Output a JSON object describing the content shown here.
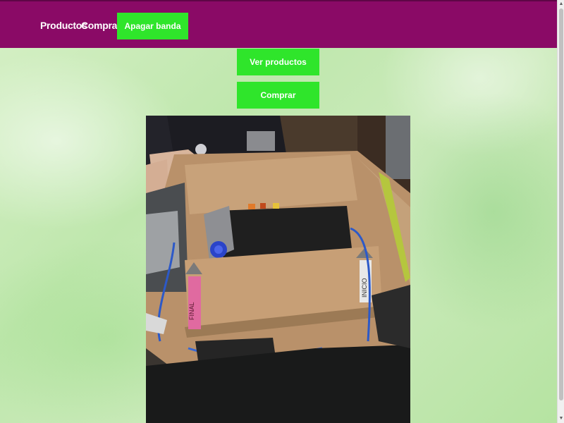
{
  "nav": {
    "productos": "Productos",
    "comprar": "Comprar",
    "apagar_banda": "Apagar banda"
  },
  "main": {
    "ver_productos": "Ver productos",
    "comprar": "Comprar"
  },
  "camera_feed": {
    "label_final": "FINAL",
    "label_inicio": "INICIO"
  },
  "colors": {
    "navbar": "#8a0a66",
    "button": "#2fe52b",
    "button_text": "#ffffff"
  }
}
